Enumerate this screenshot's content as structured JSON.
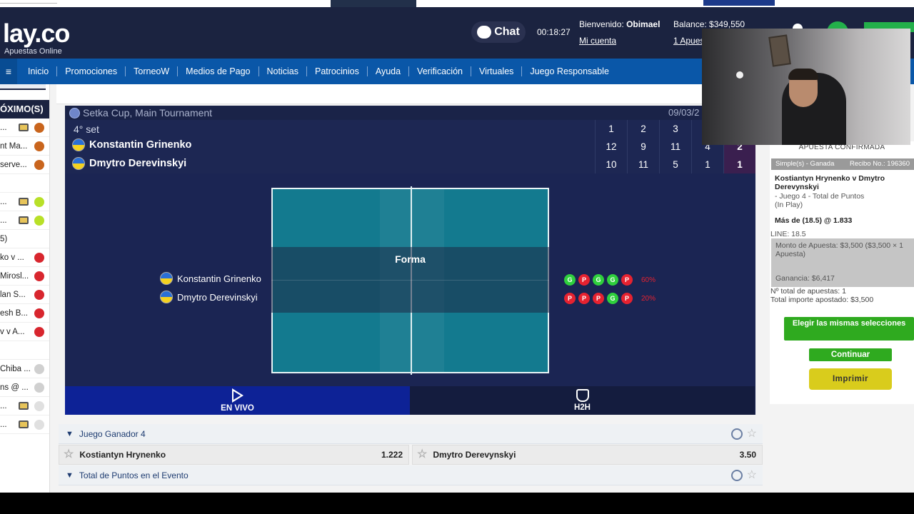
{
  "header": {
    "logo_text": "lay.co",
    "logo_sub": "Apuestas Online",
    "chat_label": "Chat",
    "clock": "00:18:27",
    "welcome_prefix": "Bienvenido:",
    "username": "Obimael",
    "account_link": "Mi cuenta",
    "balance": "Balance: $349,550",
    "bets_link": "1 Apues"
  },
  "nav": {
    "menu_icon": "≡",
    "items": [
      "Inicio",
      "Promociones",
      "TorneoW",
      "Medios de Pago",
      "Noticias",
      "Patrocinios",
      "Ayuda",
      "Verificación",
      "Virtuales",
      "Juego Responsable"
    ]
  },
  "sidebar": {
    "heading": "ÓXIMO(S)",
    "rows": [
      {
        "label": "...",
        "icon": "basketball-icon",
        "tv": true
      },
      {
        "label": "nt Ma...",
        "icon": "basketball-icon",
        "tv": false
      },
      {
        "label": "serve...",
        "icon": "basketball-icon",
        "tv": false
      },
      {
        "label": "",
        "icon": "",
        "tv": false
      },
      {
        "label": "...",
        "icon": "tennis-ball-icon",
        "tv": true
      },
      {
        "label": "...",
        "icon": "tennis-ball-icon",
        "tv": true
      },
      {
        "label": "5)",
        "icon": "",
        "tv": false
      },
      {
        "label": "ko v ...",
        "icon": "table-tennis-icon",
        "tv": false
      },
      {
        "label": "Mirosl...",
        "icon": "table-tennis-icon",
        "tv": false
      },
      {
        "label": "lan S...",
        "icon": "table-tennis-icon",
        "tv": false
      },
      {
        "label": "esh B...",
        "icon": "table-tennis-icon",
        "tv": false
      },
      {
        "label": "v v A...",
        "icon": "table-tennis-icon",
        "tv": false
      },
      {
        "label": "",
        "icon": "",
        "tv": false
      },
      {
        "label": "Chiba ...",
        "icon": "baseball-icon",
        "tv": false
      },
      {
        "label": "ns @ ...",
        "icon": "baseball-icon",
        "tv": false
      },
      {
        "label": "...",
        "icon": "volleyball-icon",
        "tv": true
      },
      {
        "label": "...",
        "icon": "volleyball-icon",
        "tv": true
      }
    ]
  },
  "scoreboard": {
    "tournament": "Setka Cup, Main Tournament",
    "date": "09/03/2",
    "set_label": "4° set",
    "set_headers": [
      "1",
      "2",
      "3"
    ],
    "players": [
      {
        "name": "Konstantin Grinenko",
        "scores": [
          "12",
          "9",
          "11",
          "4"
        ],
        "total": "2"
      },
      {
        "name": "Dmytro Derevinskyi",
        "scores": [
          "10",
          "11",
          "5",
          "1"
        ],
        "total": "1"
      }
    ],
    "forma_title": "Forma",
    "form": [
      {
        "name": "Konstantin Grinenko",
        "results": [
          "G",
          "P",
          "G",
          "G",
          "P"
        ],
        "pct": "60%"
      },
      {
        "name": "Dmytro Derevinskyi",
        "results": [
          "P",
          "P",
          "P",
          "G",
          "P"
        ],
        "pct": "20%"
      }
    ],
    "tabs": [
      {
        "label": "EN VIVO",
        "icon": "play-icon"
      },
      {
        "label": "H2H",
        "icon": "h2h-icon"
      }
    ]
  },
  "markets": [
    {
      "title": "Juego Ganador 4",
      "odds": [
        {
          "name": "Kostiantyn Hrynenko",
          "price": "1.222"
        },
        {
          "name": "Dmytro Derevynskyi",
          "price": "3.50"
        }
      ]
    },
    {
      "title": "Total de Puntos en el Evento",
      "odds": []
    }
  ],
  "betslip": {
    "confirmed": "APUESTA CONFIRMADA",
    "type": "Simple(s) - Ganada",
    "receipt": "Recibo No.: 196360",
    "match": "Kostiantyn Hrynenko v Dmytro Derevynskyi",
    "market_line1": "- Juego 4 - Total de Puntos",
    "market_line2": "(In Play)",
    "pick": "Más de (18.5) @ 1.833",
    "line": "LINE: 18.5",
    "stake": "Monto de Apuesta: $3,500 ($3,500 × 1 Apuesta)",
    "gain": "Ganancia: $6,417",
    "total_bets": "Nº total de apuestas: 1",
    "total_amount": "Total importe apostado:  $3,500",
    "same_selections": "Elegir las mismas selecciones",
    "continue": "Continuar",
    "print": "Imprimir"
  },
  "colors": {
    "header_bg": "#1b2340",
    "nav_bg": "#0a57a8",
    "scoreboard_bg": "#1d2753",
    "court": "#137a8f",
    "win": "#2fcf3d",
    "loss": "#e62230",
    "accent_green": "#2faa1f",
    "print_yellow": "#d9cc1c"
  }
}
